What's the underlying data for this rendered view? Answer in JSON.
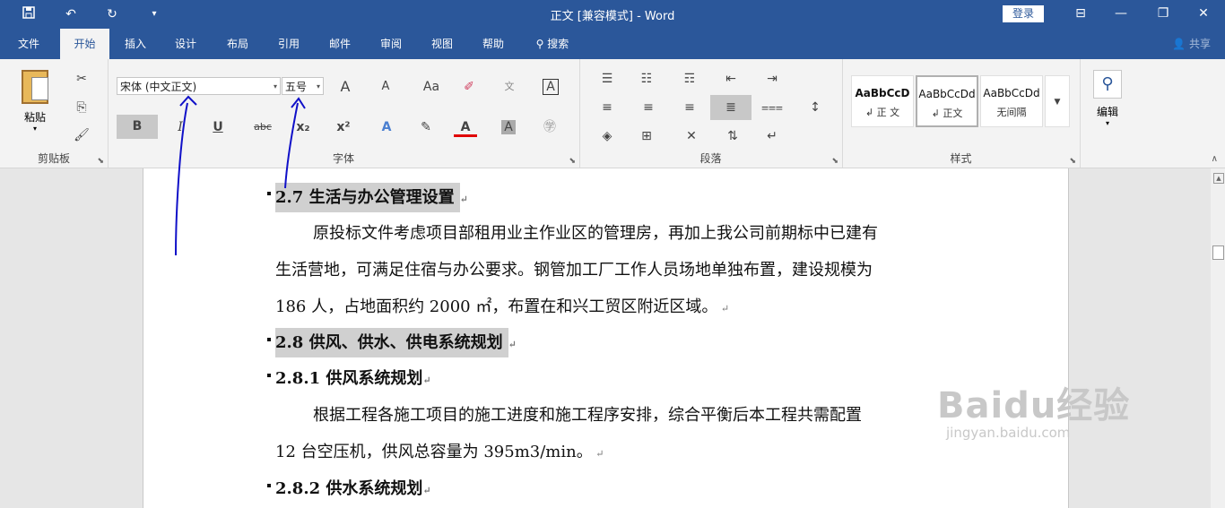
{
  "title_bar": {
    "title": "正文 [兼容模式] - Word",
    "login": "登录"
  },
  "tabs": [
    "文件",
    "开始",
    "插入",
    "设计",
    "布局",
    "引用",
    "邮件",
    "审阅",
    "视图",
    "帮助",
    "搜索"
  ],
  "share": "共享",
  "clipboard": {
    "paste": "粘贴",
    "label": "剪贴板"
  },
  "font": {
    "name": "宋体 (中文正文)",
    "size": "五号",
    "label": "字体",
    "bold": "B",
    "italic": "I",
    "underline": "U",
    "strike": "abc",
    "sub": "x₂",
    "sup": "x²",
    "aa": "Aa",
    "grow": "A",
    "shrink": "A"
  },
  "paragraph": {
    "label": "段落"
  },
  "styles": {
    "label": "样式",
    "items": [
      {
        "preview": "AaBbCcD",
        "name": "↲ 正 文"
      },
      {
        "preview": "AaBbCcDd",
        "name": "↲ 正文"
      },
      {
        "preview": "AaBbCcDd",
        "name": "无间隔"
      }
    ]
  },
  "editing": {
    "label": "编辑"
  },
  "doc": {
    "h1": "2.7 生活与办公管理设置",
    "p1": "原投标文件考虑项目部租用业主作业区的管理房，再加上我公司前期标中已建有",
    "p2": "生活营地，可满足住宿与办公要求。钢管加工厂工作人员场地单独布置，建设规模为",
    "p3": "186 人，占地面积约 2000 ㎡，布置在和兴工贸区附近区域。",
    "h2": "2.8 供风、供水、供电系统规划",
    "h3": "2.8.1 供风系统规划",
    "p4": "根据工程各施工项目的施工进度和施工程序安排，综合平衡后本工程共需配置",
    "p5": "12 台空压机，供风总容量为 395m3/min。",
    "h4": "2.8.2 供水系统规划"
  },
  "watermark": {
    "brand": "Baidu经验",
    "url": "jingyan.baidu.com"
  }
}
